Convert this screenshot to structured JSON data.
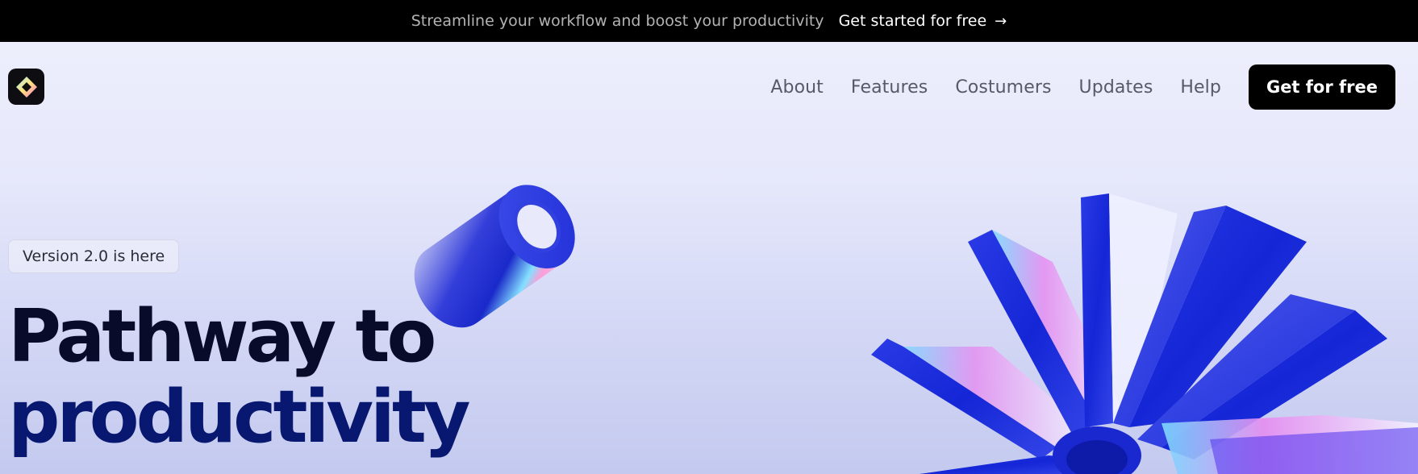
{
  "announcement": {
    "text": "Streamline your workflow and boost your productivity",
    "link_label": "Get started for free",
    "arrow": "→"
  },
  "logo": {
    "icon": "diamond-logo-icon"
  },
  "nav": {
    "items": [
      "About",
      "Features",
      "Costumers",
      "Updates",
      "Help"
    ],
    "cta_label": "Get for free"
  },
  "hero": {
    "badge": "Version 2.0 is here",
    "title_line1": "Pathway to",
    "title_line2": "productivity"
  },
  "colors": {
    "announcement_bg": "#000000",
    "cta_bg": "#000000",
    "title_dark": "#080c2a",
    "title_blue": "#081870",
    "art_blue": "#1a2ee0"
  }
}
